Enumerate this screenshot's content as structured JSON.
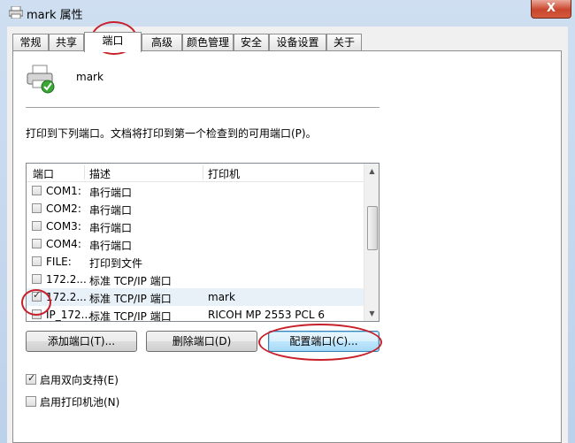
{
  "window": {
    "title": "mark 属性",
    "close_label": "X"
  },
  "tabs": [
    {
      "label": "常规"
    },
    {
      "label": "共享"
    },
    {
      "label": "端口"
    },
    {
      "label": "高级"
    },
    {
      "label": "颜色管理"
    },
    {
      "label": "安全"
    },
    {
      "label": "设备设置"
    },
    {
      "label": "关于"
    }
  ],
  "printer": {
    "name": "mark"
  },
  "description": "打印到下列端口。文档将打印到第一个检查到的可用端口(P)。",
  "ports": {
    "columns": [
      "端口",
      "描述",
      "打印机"
    ],
    "rows": [
      {
        "port": "COM1:",
        "desc": "串行端口",
        "printer": "",
        "checked": false
      },
      {
        "port": "COM2:",
        "desc": "串行端口",
        "printer": "",
        "checked": false
      },
      {
        "port": "COM3:",
        "desc": "串行端口",
        "printer": "",
        "checked": false
      },
      {
        "port": "COM4:",
        "desc": "串行端口",
        "printer": "",
        "checked": false
      },
      {
        "port": "FILE:",
        "desc": "打印到文件",
        "printer": "",
        "checked": false
      },
      {
        "port": "172.2...",
        "desc": "标准 TCP/IP 端口",
        "printer": "",
        "checked": false
      },
      {
        "port": "172.2...",
        "desc": "标准 TCP/IP 端口",
        "printer": "mark",
        "checked": true
      },
      {
        "port": "IP_172...",
        "desc": "标准 TCP/IP 端口",
        "printer": "RICOH MP 2553 PCL 6",
        "checked": false
      }
    ]
  },
  "buttons": {
    "add": "添加端口(T)...",
    "delete": "删除端口(D)",
    "configure": "配置端口(C)..."
  },
  "options": {
    "bidirectional": {
      "label": "启用双向支持(E)",
      "checked": true
    },
    "pooling": {
      "label": "启用打印机池(N)",
      "checked": false
    }
  },
  "colors": {
    "annotation": "#c8202a",
    "selected_row": "#e8f0f8"
  }
}
